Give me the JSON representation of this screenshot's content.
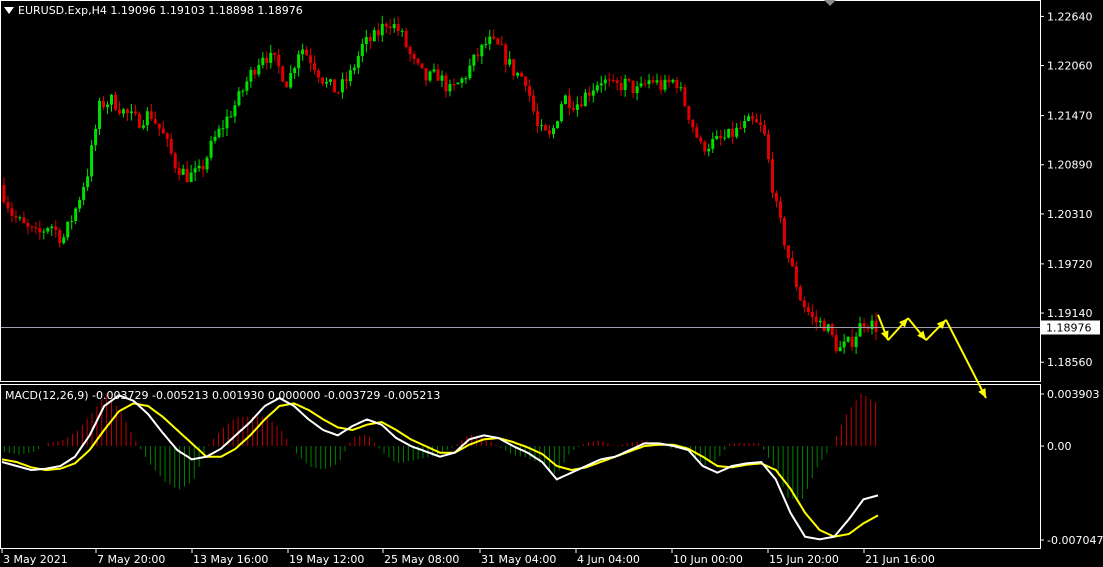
{
  "header": {
    "symbol": "EURUSD.Exp,H4",
    "ohlc": "1.19096 1.19103 1.18898 1.18976"
  },
  "macd_header": "MACD(12,26,9) -0.003729 -0.005213 0.001930 0.000000 -0.003729 -0.005213",
  "colors": {
    "background": "#000000",
    "bull": "#00e000",
    "bear": "#e00000",
    "signal": "#ffff00",
    "macd_line": "#ffffff",
    "hist_pos": "#c00000",
    "hist_neg": "#008000",
    "bid_line": "#a0a0b0",
    "frame": "#ffffff"
  },
  "chart_data": [
    {
      "type": "candlestick",
      "title": "EURUSD.Exp,H4",
      "ylim": [
        1.1835,
        1.2281
      ],
      "y_ticks": [
        "1.22640",
        "1.22060",
        "1.21470",
        "1.20890",
        "1.20310",
        "1.19720",
        "1.19140",
        "1.18560"
      ],
      "x_ticks": [
        "3 May 2021",
        "7 May 20:00",
        "13 May 16:00",
        "19 May 12:00",
        "25 May 08:00",
        "31 May 04:00",
        "4 Jun 04:00",
        "10 Jun 00:00",
        "15 Jun 20:00",
        "21 Jun 16:00"
      ],
      "bid_price": "1.18976",
      "close_path": [
        [
          "3 May 2021",
          1.2065
        ],
        [
          null,
          1.203
        ],
        [
          null,
          1.2015
        ],
        [
          null,
          1.2005
        ],
        [
          null,
          1.202
        ],
        [
          null,
          1.2
        ],
        [
          null,
          1.2035
        ],
        [
          null,
          1.208
        ],
        [
          "7 May 20:00",
          1.216
        ],
        [
          null,
          1.2165
        ],
        [
          null,
          1.215
        ],
        [
          null,
          1.214
        ],
        [
          null,
          1.215
        ],
        [
          null,
          1.2125
        ],
        [
          null,
          1.209
        ],
        [
          null,
          1.2075
        ],
        [
          "13 May 16:00",
          1.208
        ],
        [
          null,
          1.2115
        ],
        [
          null,
          1.214
        ],
        [
          null,
          1.2165
        ],
        [
          null,
          1.2195
        ],
        [
          null,
          1.222
        ],
        [
          null,
          1.221
        ],
        [
          null,
          1.2185
        ],
        [
          "19 May 12:00",
          1.223
        ],
        [
          null,
          1.221
        ],
        [
          null,
          1.2185
        ],
        [
          null,
          1.2175
        ],
        [
          null,
          1.2195
        ],
        [
          null,
          1.223
        ],
        [
          null,
          1.224
        ],
        [
          null,
          1.226
        ],
        [
          "25 May 08:00",
          1.2245
        ],
        [
          null,
          1.221
        ],
        [
          null,
          1.219
        ],
        [
          null,
          1.2195
        ],
        [
          null,
          1.2175
        ],
        [
          null,
          1.219
        ],
        [
          null,
          1.2215
        ],
        [
          null,
          1.2235
        ],
        [
          "31 May 04:00",
          1.2225
        ],
        [
          null,
          1.22
        ],
        [
          null,
          1.219
        ],
        [
          null,
          1.213
        ],
        [
          null,
          1.212
        ],
        [
          null,
          1.217
        ],
        [
          null,
          1.216
        ],
        [
          null,
          1.2175
        ],
        [
          "4 Jun 04:00",
          1.219
        ],
        [
          null,
          1.218
        ],
        [
          null,
          1.2185
        ],
        [
          null,
          1.2175
        ],
        [
          null,
          1.219
        ],
        [
          null,
          1.218
        ],
        [
          null,
          1.219
        ],
        [
          null,
          1.215
        ],
        [
          "10 Jun 00:00",
          1.211
        ],
        [
          null,
          1.2115
        ],
        [
          null,
          1.212
        ],
        [
          null,
          1.213
        ],
        [
          null,
          1.214
        ],
        [
          null,
          1.213
        ],
        [
          null,
          1.204
        ],
        [
          "15 Jun 20:00",
          1.198
        ],
        [
          null,
          1.193
        ],
        [
          null,
          1.1905
        ],
        [
          null,
          1.19
        ],
        [
          null,
          1.187
        ],
        [
          null,
          1.188
        ],
        [
          null,
          1.1905
        ],
        [
          "21 Jun 16:00",
          1.1898
        ]
      ],
      "arrows": [
        [
          1.1912,
          1.1882
        ],
        [
          1.1882,
          1.1908
        ],
        [
          1.1908,
          1.1882
        ],
        [
          1.1882,
          1.1906
        ],
        [
          1.1906,
          1.184
        ]
      ]
    },
    {
      "type": "macd",
      "title": "MACD(12,26,9)",
      "y_ticks": [
        "0.003903",
        "0.00",
        "-0.007047"
      ],
      "ylim": [
        -0.007047,
        0.003903
      ],
      "values": {
        "macd_main": -0.003729,
        "signal": -0.005213,
        "histogram": 0.00193
      },
      "macd_line": [
        -0.0012,
        -0.0015,
        -0.0018,
        -0.0017,
        -0.0015,
        -0.0008,
        0.0008,
        0.003,
        0.0038,
        0.0034,
        0.0024,
        0.001,
        -0.0003,
        -0.001,
        -0.0008,
        -0.0002,
        0.0008,
        0.0018,
        0.003,
        0.0036,
        0.003,
        0.002,
        0.0012,
        0.0008,
        0.0015,
        0.002,
        0.0016,
        0.0006,
        0.0,
        -0.0004,
        -0.0008,
        -0.0005,
        0.0005,
        0.0008,
        0.0006,
        0.0,
        -0.0005,
        -0.0012,
        -0.0025,
        -0.002,
        -0.0015,
        -0.001,
        -0.0008,
        -0.0003,
        0.0002,
        0.0002,
        0.0,
        -0.0003,
        -0.0015,
        -0.002,
        -0.0015,
        -0.0013,
        -0.0012,
        -0.0025,
        -0.005,
        -0.0068,
        -0.007,
        -0.0068,
        -0.0055,
        -0.004,
        -0.0037
      ],
      "signal_line": [
        -0.001,
        -0.0012,
        -0.0016,
        -0.0018,
        -0.0017,
        -0.0013,
        -0.0003,
        0.0012,
        0.0026,
        0.0032,
        0.003,
        0.0022,
        0.0012,
        0.0002,
        -0.0008,
        -0.0008,
        -0.0002,
        0.0008,
        0.002,
        0.003,
        0.0032,
        0.0027,
        0.002,
        0.0014,
        0.0012,
        0.0016,
        0.0018,
        0.0012,
        0.0005,
        0.0,
        -0.0005,
        -0.0005,
        0.0001,
        0.0005,
        0.0006,
        0.0003,
        -0.0001,
        -0.0006,
        -0.0015,
        -0.0018,
        -0.0016,
        -0.0012,
        -0.0008,
        -0.0004,
        0.0,
        0.0001,
        0.0001,
        -0.0002,
        -0.0008,
        -0.0015,
        -0.0016,
        -0.0014,
        -0.0013,
        -0.0018,
        -0.0032,
        -0.005,
        -0.0063,
        -0.0068,
        -0.0066,
        -0.0058,
        -0.0052
      ]
    }
  ]
}
